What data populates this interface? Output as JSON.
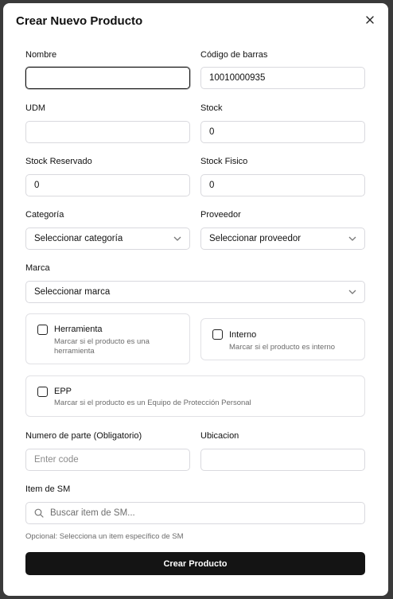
{
  "dialog": {
    "title": "Crear Nuevo Producto"
  },
  "fields": {
    "nombre": {
      "label": "Nombre",
      "value": ""
    },
    "codigo_barras": {
      "label": "Código de barras",
      "value": "10010000935"
    },
    "udm": {
      "label": "UDM",
      "value": ""
    },
    "stock": {
      "label": "Stock",
      "value": "0"
    },
    "stock_reservado": {
      "label": "Stock Reservado",
      "value": "0"
    },
    "stock_fisico": {
      "label": "Stock Fisico",
      "value": "0"
    },
    "categoria": {
      "label": "Categoría",
      "selected": "Seleccionar categoría"
    },
    "proveedor": {
      "label": "Proveedor",
      "selected": "Seleccionar proveedor"
    },
    "marca": {
      "label": "Marca",
      "selected": "Seleccionar marca"
    },
    "numero_parte": {
      "label": "Numero de parte (Obligatorio)",
      "placeholder": "Enter code",
      "value": ""
    },
    "ubicacion": {
      "label": "Ubicacion",
      "value": ""
    },
    "item_sm": {
      "label": "Item de SM",
      "placeholder": "Buscar item de SM...",
      "hint": "Opcional: Selecciona un item específico de SM"
    }
  },
  "checkboxes": {
    "herramienta": {
      "title": "Herramienta",
      "desc": "Marcar si el producto es una herramienta",
      "checked": false
    },
    "interno": {
      "title": "Interno",
      "desc": "Marcar si el producto es interno",
      "checked": false
    },
    "epp": {
      "title": "EPP",
      "desc": "Marcar si el producto es un Equipo de Protección Personal",
      "checked": false
    }
  },
  "submit_label": "Crear Producto",
  "icons": {
    "close": "close-icon",
    "chevron": "chevron-down-icon",
    "search": "search-icon"
  }
}
